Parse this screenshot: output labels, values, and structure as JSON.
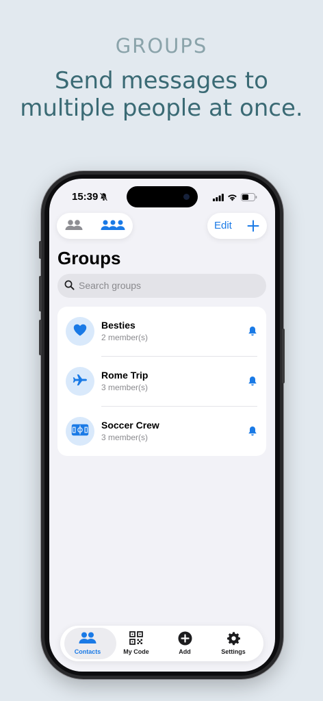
{
  "hero": {
    "eyebrow": "GROUPS",
    "title_line1": "Send messages to",
    "title_line2": "multiple people at once."
  },
  "status_bar": {
    "time": "15:39",
    "silent_icon": "bell-slash-icon",
    "icons": [
      "cellular-signal-icon",
      "wifi-icon",
      "battery-icon"
    ]
  },
  "toolbar": {
    "segments": [
      {
        "icon": "person-2-icon",
        "selected": false
      },
      {
        "icon": "person-3-icon",
        "selected": true
      }
    ],
    "edit_label": "Edit",
    "add_icon": "plus-icon"
  },
  "page": {
    "title": "Groups"
  },
  "search": {
    "placeholder": "Search groups"
  },
  "groups": [
    {
      "name": "Besties",
      "members": "2 member(s)",
      "icon": "heart-icon"
    },
    {
      "name": "Rome Trip",
      "members": "3 member(s)",
      "icon": "airplane-icon"
    },
    {
      "name": "Soccer Crew",
      "members": "3 member(s)",
      "icon": "soccer-field-icon"
    }
  ],
  "tabbar": {
    "tabs": [
      {
        "label": "Contacts",
        "icon": "person-2-icon",
        "active": true
      },
      {
        "label": "My Code",
        "icon": "qrcode-icon",
        "active": false
      },
      {
        "label": "Add",
        "icon": "plus-circle-icon",
        "active": false
      },
      {
        "label": "Settings",
        "icon": "gear-icon",
        "active": false
      }
    ]
  },
  "colors": {
    "accent": "#1a7ae6",
    "background": "#e2e9ef",
    "avatar_bg": "#d9e9fb",
    "hero_title": "#3a6a74",
    "hero_eyebrow": "#8aa3aa"
  }
}
